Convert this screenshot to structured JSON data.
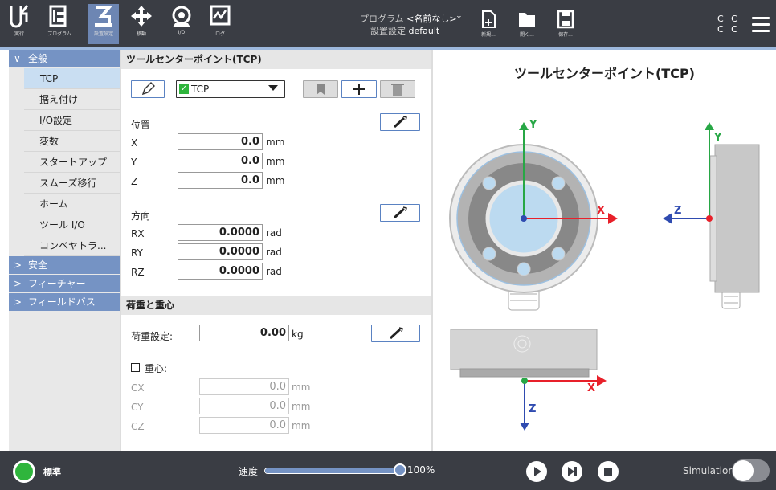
{
  "topbar": {
    "tabs": [
      {
        "id": "run",
        "label": "実行"
      },
      {
        "id": "program",
        "label": "プログラム"
      },
      {
        "id": "installation",
        "label": "設置設定"
      },
      {
        "id": "move",
        "label": "移動"
      },
      {
        "id": "io",
        "label": "I/O"
      },
      {
        "id": "log",
        "label": "ログ"
      }
    ],
    "program_label": "プログラム",
    "program_value": "<名前なし>*",
    "installation_label": "設置設定",
    "installation_value": "default",
    "file_buttons": [
      {
        "id": "new",
        "label": "新規..."
      },
      {
        "id": "open",
        "label": "開く..."
      },
      {
        "id": "save",
        "label": "保存..."
      }
    ],
    "status_top": "C C",
    "status_bottom": "C C"
  },
  "sidebar": {
    "general": "全般",
    "items": [
      "TCP",
      "据え付け",
      "I/O設定",
      "変数",
      "スタートアップ",
      "スムーズ移行",
      "ホーム",
      "ツール I/O",
      "コンベヤトラ..."
    ],
    "safety": "安全",
    "features": "フィーチャー",
    "fieldbus": "フィールドバス"
  },
  "tcp": {
    "header": "ツールセンターポイント(TCP)",
    "selected": "TCP",
    "position_label": "位置",
    "orientation_label": "方向",
    "x_label": "X",
    "x_value": "0.0",
    "y_label": "Y",
    "y_value": "0.0",
    "z_label": "Z",
    "z_value": "0.0",
    "mm": "mm",
    "rx_label": "RX",
    "rx_value": "0.0000",
    "ry_label": "RY",
    "ry_value": "0.0000",
    "rz_label": "RZ",
    "rz_value": "0.0000",
    "rad": "rad"
  },
  "payload": {
    "header": "荷重と重心",
    "payload_label": "荷重設定:",
    "payload_value": "0.00",
    "kg": "kg",
    "cog_label": "重心:",
    "cx_label": "CX",
    "cx_value": "0.0",
    "cy_label": "CY",
    "cy_value": "0.0",
    "cz_label": "CZ",
    "cz_value": "0.0",
    "mm": "mm"
  },
  "view": {
    "title": "ツールセンターポイント(TCP)",
    "front_x": "X",
    "front_y": "Y",
    "side_y": "Y",
    "side_z": "Z",
    "bottom_x": "X",
    "bottom_z": "Z"
  },
  "footer": {
    "mode": "標準",
    "speed_label": "速度",
    "speed_value": "100%",
    "speed_fraction": 1.0,
    "simulation_label": "Simulation"
  },
  "colors": {
    "topbar": "#3a3d44",
    "accent": "#7593c4",
    "x_axis": "#e8202a",
    "y_axis": "#27a745",
    "z_axis": "#2f4bb0",
    "status_green": "#2fb53c"
  }
}
